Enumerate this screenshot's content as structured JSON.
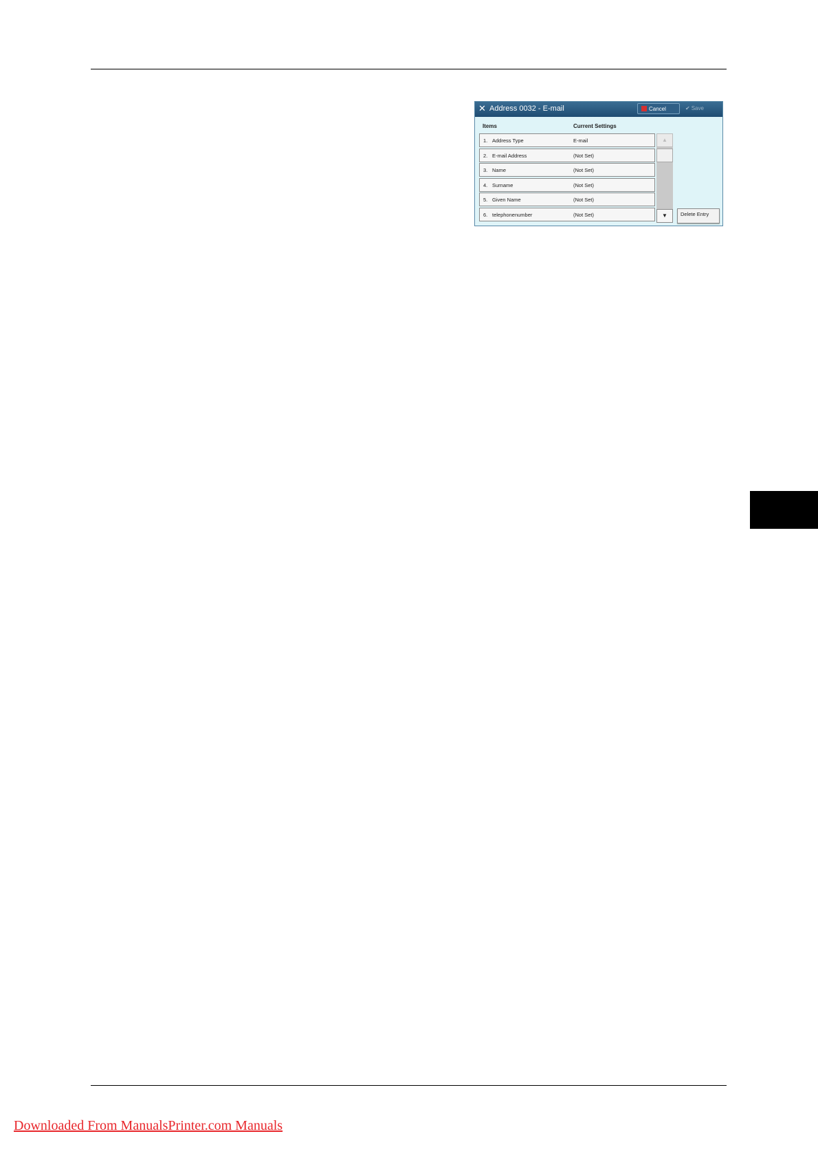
{
  "dialog": {
    "title": "Address 0032 - E-mail",
    "cancel_label": "Cancel",
    "save_label": "Save",
    "col_items": "Items",
    "col_current_settings": "Current Settings",
    "rows": [
      {
        "num": "1.",
        "label": "Address Type",
        "value": "E-mail"
      },
      {
        "num": "2.",
        "label": "E-mail Address",
        "value": "(Not Set)"
      },
      {
        "num": "3.",
        "label": "Name",
        "value": "(Not Set)"
      },
      {
        "num": "4.",
        "label": "Surname",
        "value": "(Not Set)"
      },
      {
        "num": "5.",
        "label": "Given Name",
        "value": "(Not Set)"
      },
      {
        "num": "6.",
        "label": "telephonenumber",
        "value": "(Not Set)"
      }
    ],
    "delete_label": "Delete Entry"
  },
  "footer": {
    "link_text": "Downloaded From ManualsPrinter.com Manuals"
  },
  "icons": {
    "title": "tools-icon",
    "cancel": "cancel-icon",
    "save": "checkmark-icon",
    "scroll_up": "arrow-up-icon",
    "scroll_down": "arrow-down-icon"
  },
  "colors": {
    "titlebar": "#1f4c72",
    "dialog_bg": "#dff4f8",
    "footer_link": "#e8262b"
  }
}
